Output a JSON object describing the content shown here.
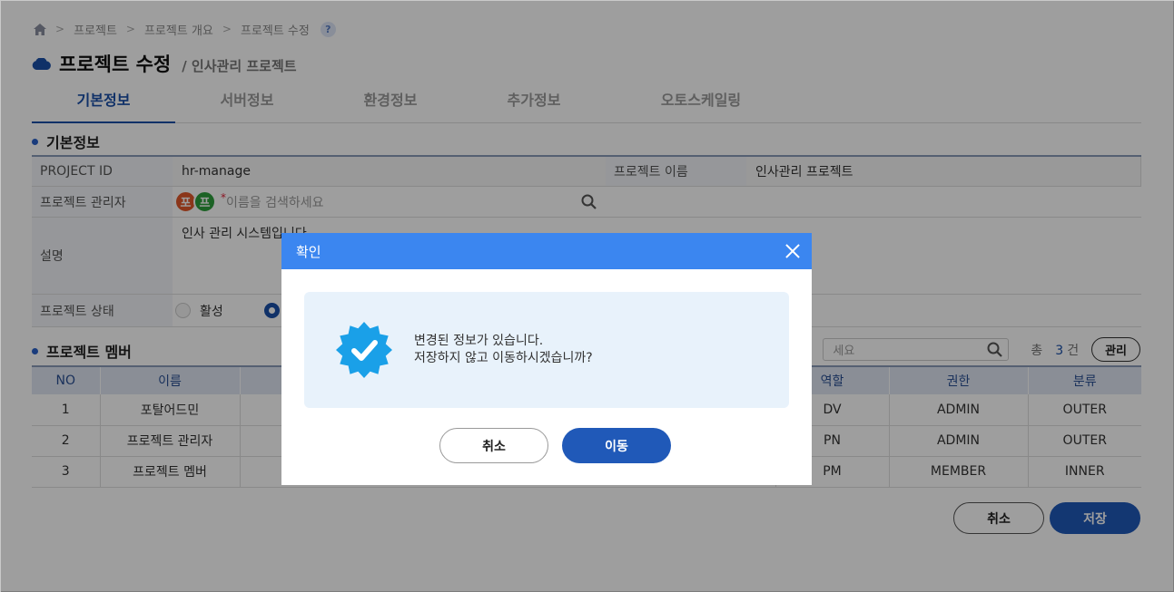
{
  "breadcrumb": {
    "items": [
      "프로젝트",
      "프로젝트 개요",
      "프로젝트 수정"
    ],
    "help": "?"
  },
  "header": {
    "title": "프로젝트 수정",
    "subtitle": "/ 인사관리 프로젝트"
  },
  "tabs": [
    "기본정보",
    "서버정보",
    "환경정보",
    "추가정보",
    "오토스케일링"
  ],
  "basic": {
    "section_title": "기본정보",
    "project_id_label": "PROJECT ID",
    "project_id": "hr-manage",
    "project_name_label": "프로젝트 이름",
    "project_name": "인사관리 프로젝트",
    "manager_label": "프로젝트 관리자",
    "manager_avatars": [
      "포",
      "프"
    ],
    "manager_required": "*",
    "manager_placeholder": "이름을 검색하세요",
    "description_label": "설명",
    "description": "인사 관리 시스템입니다",
    "status_label": "프로젝트 상태",
    "status_active": "활성"
  },
  "members": {
    "section_title": "프로젝트 멤버",
    "search_placeholder": "세요",
    "total_label": "총",
    "total_count": "3",
    "total_unit": "건",
    "manage_button": "관리",
    "columns": [
      "NO",
      "이름",
      "",
      "역할",
      "권한",
      "분류"
    ],
    "rows": [
      {
        "no": "1",
        "name": "포탈어드민",
        "role": "DV",
        "perm": "ADMIN",
        "type": "OUTER"
      },
      {
        "no": "2",
        "name": "프로젝트 관리자",
        "role": "PN",
        "perm": "ADMIN",
        "type": "OUTER"
      },
      {
        "no": "3",
        "name": "프로젝트 멤버",
        "role": "PM",
        "perm": "MEMBER",
        "type": "INNER"
      }
    ]
  },
  "footer": {
    "cancel": "취소",
    "save": "저장"
  },
  "modal": {
    "title": "확인",
    "line1": "변경된 정보가 있습니다.",
    "line2": "저장하지 않고 이동하시겠습니까?",
    "cancel": "취소",
    "confirm": "이동"
  },
  "colors": {
    "accent": "#2059b8",
    "modal_header": "#3b86f0",
    "badge": "#1aa0e8",
    "avatar_1": "#e0582a",
    "avatar_2": "#2e9e3c"
  }
}
